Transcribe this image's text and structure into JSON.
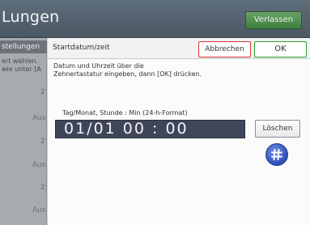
{
  "header": {
    "title": "Lungen",
    "exit_label": "Verlassen"
  },
  "sidebar": {
    "active_tab": "stellungen",
    "note_lines": [
      "ert wählen.",
      "wie unter [A"
    ],
    "values": [
      "2",
      "Aus",
      "2",
      "Aus",
      "2",
      "Aus"
    ]
  },
  "dialog": {
    "title": "Startdatum/zeit",
    "cancel_label": "Abbrechen",
    "ok_label": "OK",
    "description_lines": [
      "Datum und Uhrzeit über die",
      "Zehnertastatur eingeben, dann [OK] drücken."
    ],
    "format_label": "Tag/Monat, Stunde : Min (24-h-Format)",
    "value_display": "01/01  00 : 00",
    "delete_label": "Löschen",
    "hash_key": "#",
    "hash_icon": "hash-key-icon"
  },
  "colors": {
    "header_bg": "#55636e",
    "display_bg": "#40465a",
    "cancel_border": "#dd3333",
    "ok_border": "#2fa02f",
    "hash_bg": "#3a5cc8"
  }
}
